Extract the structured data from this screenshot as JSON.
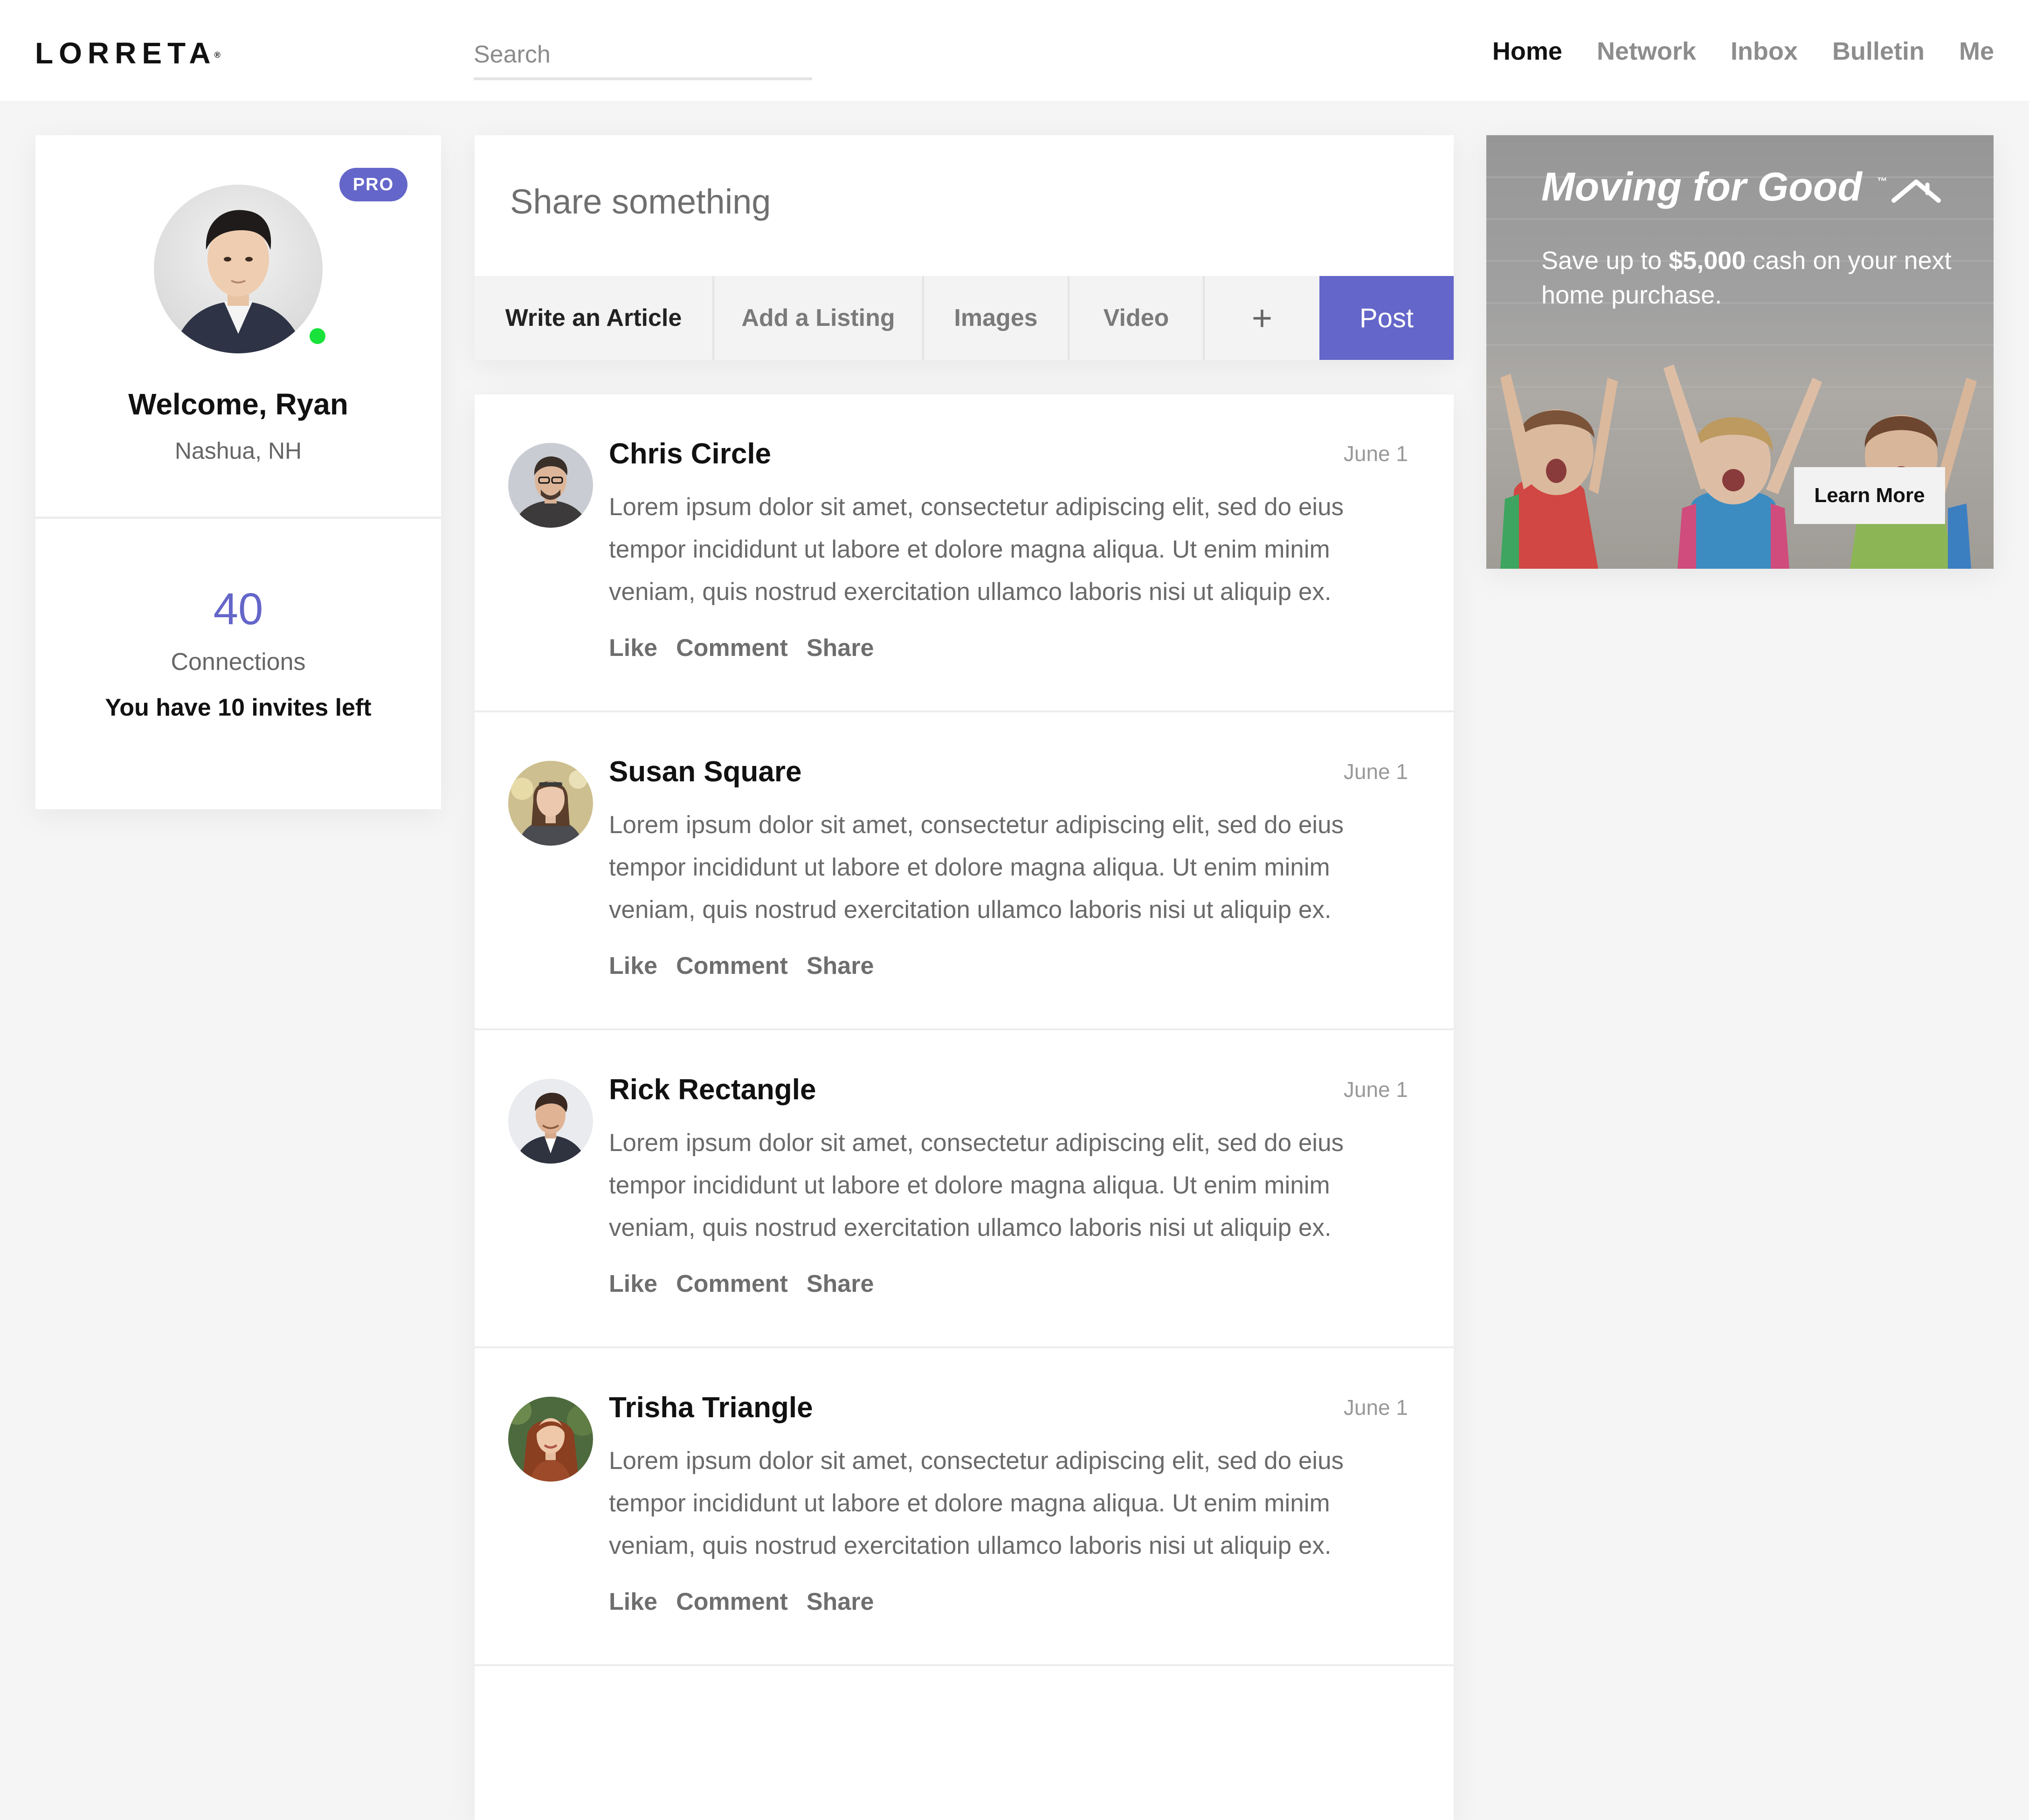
{
  "brand": {
    "name": "LORRETA",
    "mark": "®"
  },
  "search": {
    "placeholder": "Search"
  },
  "nav": {
    "items": [
      {
        "label": "Home",
        "active": true
      },
      {
        "label": "Network"
      },
      {
        "label": "Inbox"
      },
      {
        "label": "Bulletin"
      },
      {
        "label": "Me"
      }
    ]
  },
  "profile": {
    "badge": "PRO",
    "welcome": "Welcome, Ryan",
    "location": "Nashua, NH",
    "connections_count": "40",
    "connections_label": "Connections",
    "invites_text": "You have 10 invites left",
    "online": true
  },
  "composer": {
    "placeholder": "Share something",
    "actions": [
      "Write an Article",
      "Add a Listing",
      "Images",
      "Video",
      "+"
    ],
    "post_label": "Post"
  },
  "feed": {
    "posts": [
      {
        "author": "Chris Circle",
        "date": "June 1",
        "body": "Lorem ipsum dolor sit amet, consectetur adipiscing elit, sed do eius tempor incididunt ut labore et dolore magna aliqua. Ut enim minim veniam, quis nostrud exercitation ullamco laboris nisi ut aliquip ex.",
        "actions": [
          "Like",
          "Comment",
          "Share"
        ]
      },
      {
        "author": "Susan Square",
        "date": "June 1",
        "body": "Lorem ipsum dolor sit amet, consectetur adipiscing elit, sed do eius tempor incididunt ut labore et dolore magna aliqua. Ut enim minim veniam, quis nostrud exercitation ullamco laboris nisi ut aliquip ex.",
        "actions": [
          "Like",
          "Comment",
          "Share"
        ]
      },
      {
        "author": "Rick Rectangle",
        "date": "June 1",
        "body": "Lorem ipsum dolor sit amet, consectetur adipiscing elit, sed do eius tempor incididunt ut labore et dolore magna aliqua. Ut enim minim veniam, quis nostrud exercitation ullamco laboris nisi ut aliquip ex.",
        "actions": [
          "Like",
          "Comment",
          "Share"
        ]
      },
      {
        "author": "Trisha Triangle",
        "date": "June 1",
        "body": "Lorem ipsum dolor sit amet, consectetur adipiscing elit, sed do eius tempor incididunt ut labore et dolore magna aliqua. Ut enim minim veniam, quis nostrud exercitation ullamco laboris nisi ut aliquip ex.",
        "actions": [
          "Like",
          "Comment",
          "Share"
        ]
      }
    ]
  },
  "ad": {
    "title": "Moving for Good",
    "trademark": "™",
    "copy_prefix": "Save up to ",
    "copy_amount": "$5,000",
    "copy_suffix": " cash on your next home purchase.",
    "cta": "Learn More"
  },
  "colors": {
    "accent": "#6466c9",
    "online": "#19e23b",
    "background": "#f5f5f5",
    "card": "#ffffff"
  }
}
